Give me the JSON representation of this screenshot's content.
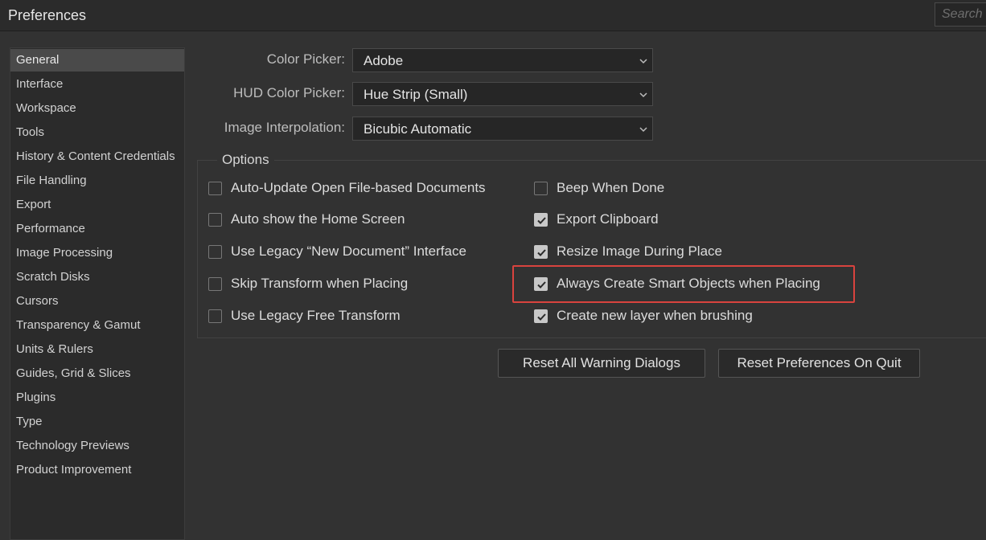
{
  "window": {
    "title": "Preferences",
    "search_placeholder": "Search"
  },
  "sidebar": {
    "items": [
      {
        "label": "General",
        "active": true
      },
      {
        "label": "Interface"
      },
      {
        "label": "Workspace"
      },
      {
        "label": "Tools"
      },
      {
        "label": "History & Content Credentials"
      },
      {
        "label": "File Handling"
      },
      {
        "label": "Export"
      },
      {
        "label": "Performance"
      },
      {
        "label": "Image Processing"
      },
      {
        "label": "Scratch Disks"
      },
      {
        "label": "Cursors"
      },
      {
        "label": "Transparency & Gamut"
      },
      {
        "label": "Units & Rulers"
      },
      {
        "label": "Guides, Grid & Slices"
      },
      {
        "label": "Plugins"
      },
      {
        "label": "Type"
      },
      {
        "label": "Technology Previews"
      },
      {
        "label": "Product Improvement"
      }
    ]
  },
  "general": {
    "color_picker": {
      "label": "Color Picker:",
      "value": "Adobe"
    },
    "hud_color_picker": {
      "label": "HUD Color Picker:",
      "value": "Hue Strip (Small)"
    },
    "image_interpolation": {
      "label": "Image Interpolation:",
      "value": "Bicubic Automatic"
    }
  },
  "options": {
    "title": "Options",
    "left": [
      {
        "label": "Auto-Update Open File-based Documents",
        "checked": false
      },
      {
        "label": "Auto show the Home Screen",
        "checked": false
      },
      {
        "label": "Use Legacy “New Document” Interface",
        "checked": false
      },
      {
        "label": "Skip Transform when Placing",
        "checked": false
      },
      {
        "label": "Use Legacy Free Transform",
        "checked": false
      }
    ],
    "right": [
      {
        "label": "Beep When Done",
        "checked": false
      },
      {
        "label": "Export Clipboard",
        "checked": true
      },
      {
        "label": "Resize Image During Place",
        "checked": true
      },
      {
        "label": "Always Create Smart Objects when Placing",
        "checked": true
      },
      {
        "label": "Create new layer when brushing",
        "checked": true
      }
    ]
  },
  "buttons": {
    "reset_warnings": "Reset All Warning Dialogs",
    "reset_prefs": "Reset Preferences On Quit"
  },
  "colors": {
    "background": "#323232",
    "highlight": "#d9433e"
  }
}
